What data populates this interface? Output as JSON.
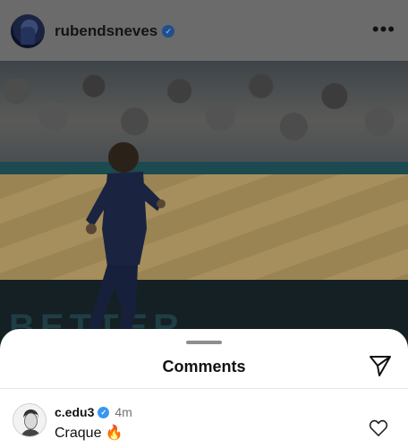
{
  "post": {
    "username": "rubendsneves",
    "verified_icon": "verified-badge-icon",
    "more_label": "•••",
    "board_text": "BETTER"
  },
  "comments_sheet": {
    "title": "Comments",
    "share_icon": "send-icon",
    "comments": [
      {
        "username": "c.edu3",
        "time": "4m",
        "text": "Craque 🔥",
        "like_icon": "heart-icon"
      }
    ]
  },
  "colors": {
    "verified_blue": "#3797f0",
    "sheet_bg": "#ffffff",
    "overlay_dim": "#6b6b6b"
  }
}
